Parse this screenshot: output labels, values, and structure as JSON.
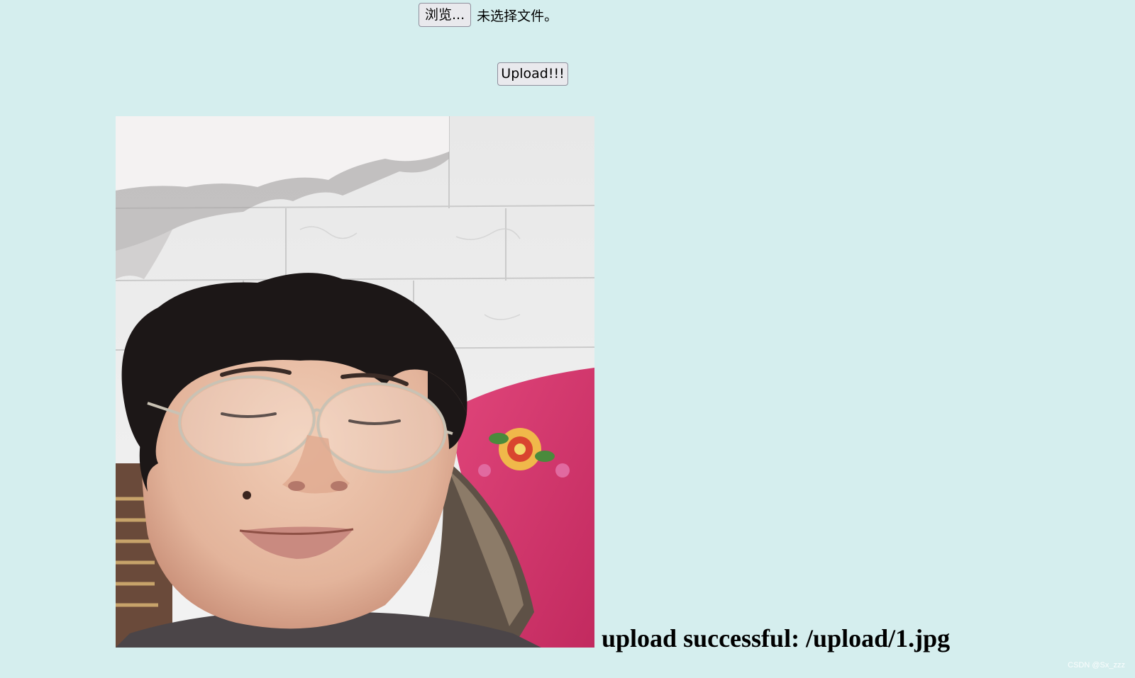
{
  "file_input": {
    "browse_label": "浏览...",
    "status_text": "未选择文件。"
  },
  "upload_button_label": "Upload!!!",
  "uploaded_image": {
    "description_icon": "uploaded-photo",
    "alt": ""
  },
  "result_message": "upload successful: /upload/1.jpg",
  "watermark": "CSDN @Sx_zzz",
  "colors": {
    "background": "#d5eeee",
    "button_bg": "#e9e9ed",
    "button_border": "#8f8f9d",
    "text": "#000000"
  }
}
